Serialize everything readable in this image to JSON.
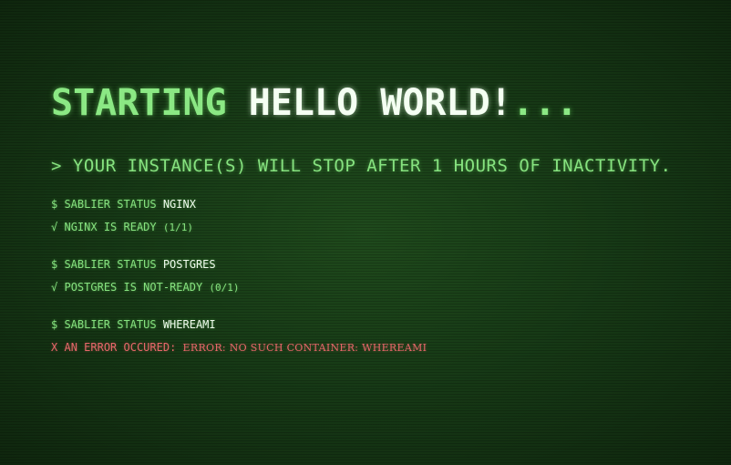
{
  "header": {
    "prefix": "STARTING",
    "app_name": "HELLO WORLD!",
    "suffix": "..."
  },
  "notice": "> YOUR INSTANCE(S) WILL STOP AFTER 1 HOURS OF INACTIVITY.",
  "statuses": [
    {
      "command": "$ SABLIER STATUS",
      "target": "NGINX",
      "result_mark": "√",
      "result_text": "NGINX IS READY",
      "result_detail": "(1/1)"
    },
    {
      "command": "$ SABLIER STATUS",
      "target": "POSTGRES",
      "result_mark": "√",
      "result_text": "POSTGRES IS NOT-READY",
      "result_detail": "(0/1)"
    },
    {
      "command": "$ SABLIER STATUS",
      "target": "WHEREAMI",
      "result_mark": "X",
      "result_text": "AN ERROR OCCURED:",
      "result_detail": "ERROR: NO SUCH CONTAINER: WHEREAMI"
    }
  ],
  "colors": {
    "background": "#173a16",
    "text_green": "#86e27f",
    "text_white": "#f0fbee",
    "error_red": "#e7676a"
  }
}
